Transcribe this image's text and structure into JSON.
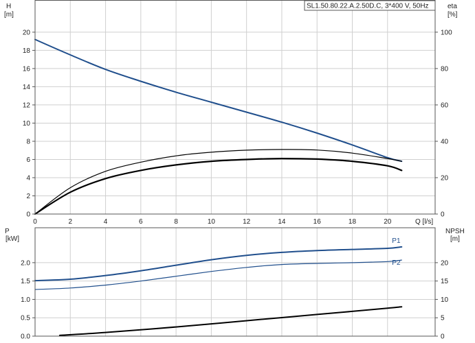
{
  "chart_data": [
    {
      "type": "line",
      "title": "SL1.50.80.22.A.2.50D.C, 3*400 V, 50Hz",
      "xlabel": "Q [l/s]",
      "ylabel": [
        "H",
        "[m]"
      ],
      "ylabel_right": [
        "eta",
        "[%]"
      ],
      "xlim": [
        0,
        22.7
      ],
      "ylim": [
        0,
        23.5
      ],
      "ylim_right": [
        0,
        117.5
      ],
      "x_ticks": [
        0,
        2,
        4,
        6,
        8,
        10,
        12,
        14,
        16,
        18,
        20
      ],
      "y_ticks": [
        0,
        2,
        4,
        6,
        8,
        10,
        12,
        14,
        16,
        18,
        20
      ],
      "y_ticks_right": [
        0,
        20,
        40,
        60,
        80,
        100
      ],
      "grid": true,
      "series": [
        {
          "axis": "left",
          "color": "#1f4e8c",
          "width": 2,
          "x": [
            0,
            2,
            4,
            6,
            8,
            10,
            12,
            14,
            16,
            18,
            20,
            20.8
          ],
          "values": [
            19.2,
            17.5,
            15.9,
            14.6,
            13.4,
            12.3,
            11.2,
            10.1,
            8.9,
            7.6,
            6.2,
            5.8
          ]
        },
        {
          "axis": "right",
          "color": "#000000",
          "width": 1.2,
          "x": [
            0,
            2,
            4,
            6,
            8,
            10,
            12,
            14,
            16,
            18,
            20,
            20.8
          ],
          "values": [
            0,
            14.5,
            23.5,
            28.5,
            32,
            34,
            35.1,
            35.5,
            35.2,
            33.5,
            30.5,
            29
          ]
        },
        {
          "axis": "right",
          "color": "#000000",
          "width": 2.2,
          "x": [
            0,
            2,
            4,
            6,
            8,
            10,
            12,
            14,
            16,
            18,
            20,
            20.8
          ],
          "values": [
            0,
            12,
            19.5,
            24,
            27,
            29,
            30,
            30.5,
            30.2,
            29,
            26.5,
            24
          ]
        }
      ]
    },
    {
      "type": "line",
      "xlabel": "",
      "ylabel": [
        "P",
        "[kW]"
      ],
      "ylabel_right": [
        "NPSH",
        "[m]"
      ],
      "xlim": [
        0,
        22.7
      ],
      "ylim": [
        0,
        2.95
      ],
      "ylim_right": [
        0,
        29.5
      ],
      "x_ticks": [],
      "y_ticks": [
        0.0,
        0.5,
        1.0,
        1.5,
        2.0
      ],
      "y_tick_labels": [
        "0.0",
        "0.5",
        "1.0",
        "1.5",
        "2.0"
      ],
      "y_ticks_right": [
        0,
        5,
        10,
        15,
        20
      ],
      "grid": true,
      "series": [
        {
          "name": "P1",
          "axis": "left",
          "color": "#1f4e8c",
          "width": 2,
          "x": [
            0,
            2,
            4,
            6,
            8,
            10,
            12,
            14,
            16,
            18,
            20,
            20.8
          ],
          "values": [
            1.51,
            1.55,
            1.65,
            1.78,
            1.93,
            2.08,
            2.2,
            2.28,
            2.33,
            2.36,
            2.39,
            2.43
          ]
        },
        {
          "name": "P2",
          "axis": "left",
          "color": "#1f4e8c",
          "width": 1.2,
          "x": [
            0,
            2,
            4,
            6,
            8,
            10,
            12,
            14,
            16,
            18,
            20,
            20.8
          ],
          "values": [
            1.27,
            1.31,
            1.39,
            1.5,
            1.63,
            1.76,
            1.87,
            1.95,
            1.98,
            2.0,
            2.03,
            2.07
          ]
        },
        {
          "axis": "right",
          "color": "#000000",
          "width": 2,
          "x": [
            1.4,
            4,
            8,
            12,
            16,
            20,
            20.8
          ],
          "values": [
            0.2,
            1.0,
            2.5,
            4.2,
            5.9,
            7.6,
            8.0
          ]
        }
      ]
    }
  ]
}
